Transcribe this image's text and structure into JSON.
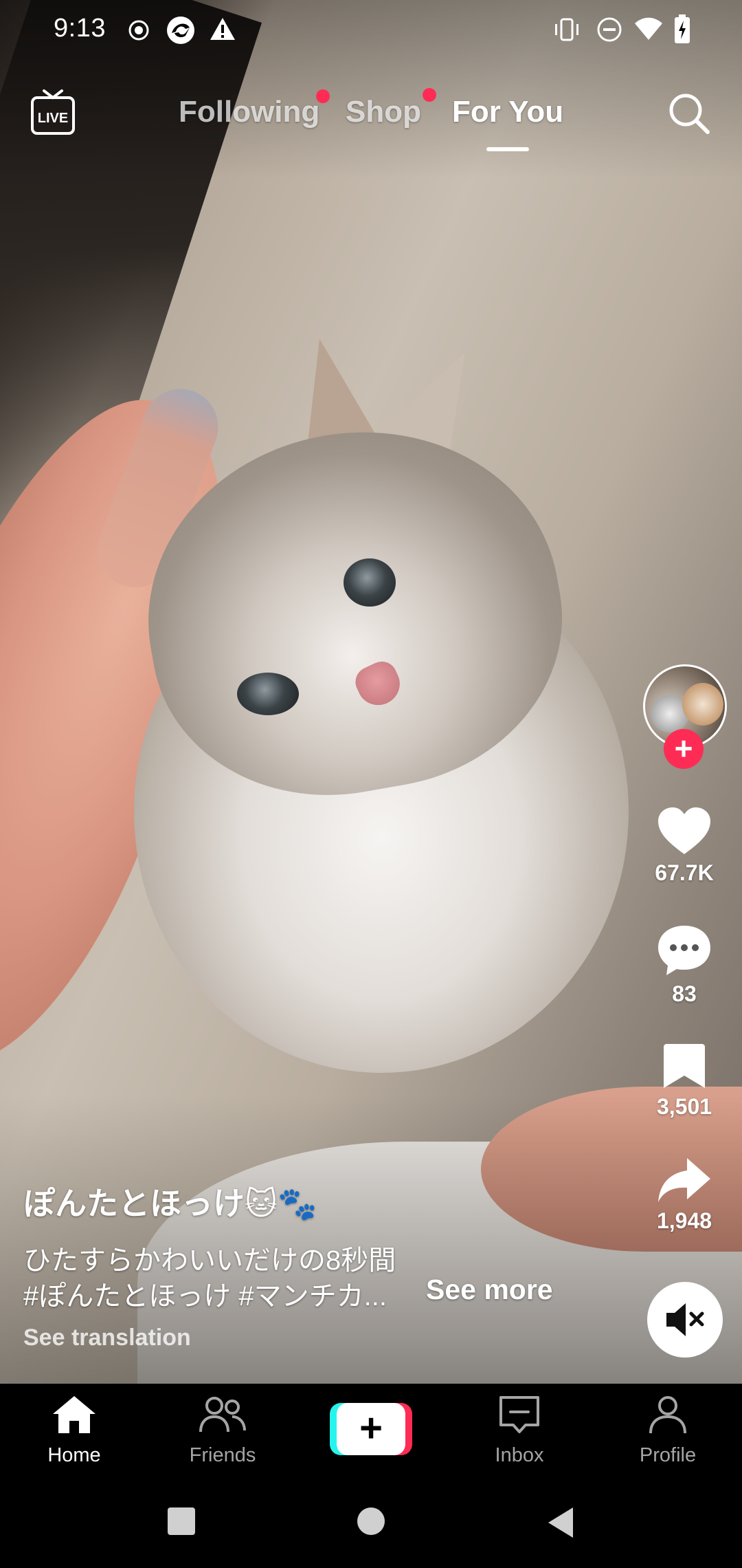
{
  "status_bar": {
    "time": "9:13",
    "icons": [
      "record-icon",
      "data-saver-icon",
      "warning-icon",
      "vibrate-icon",
      "do-not-disturb-icon",
      "wifi-icon",
      "battery-charging-icon"
    ]
  },
  "top_nav": {
    "live_label": "LIVE",
    "tabs": [
      {
        "label": "Following",
        "has_dot": true
      },
      {
        "label": "Shop",
        "has_dot": true
      },
      {
        "label": "For You",
        "active": true
      }
    ]
  },
  "video": {
    "description_icon": "video-frame"
  },
  "right_rail": {
    "like_count": "67.7K",
    "comment_count": "83",
    "bookmark_count": "3,501",
    "share_count": "1,948",
    "follow_symbol": "+"
  },
  "caption": {
    "username": "ぽんたとほっけ🐱🐾",
    "line1": "ひたすらかわいいだけの8秒間",
    "line2": "#ぽんたとほっけ #マンチカ...",
    "see_more": "See more",
    "see_translation": "See translation"
  },
  "bottom_nav": {
    "items": [
      {
        "label": "Home",
        "active": true
      },
      {
        "label": "Friends"
      },
      {
        "label": ""
      },
      {
        "label": "Inbox"
      },
      {
        "label": "Profile"
      }
    ],
    "create_symbol": "+"
  },
  "colors": {
    "accent_red": "#fe2c55",
    "accent_cyan": "#25f4ee",
    "inactive_nav": "#a5a5a5"
  }
}
